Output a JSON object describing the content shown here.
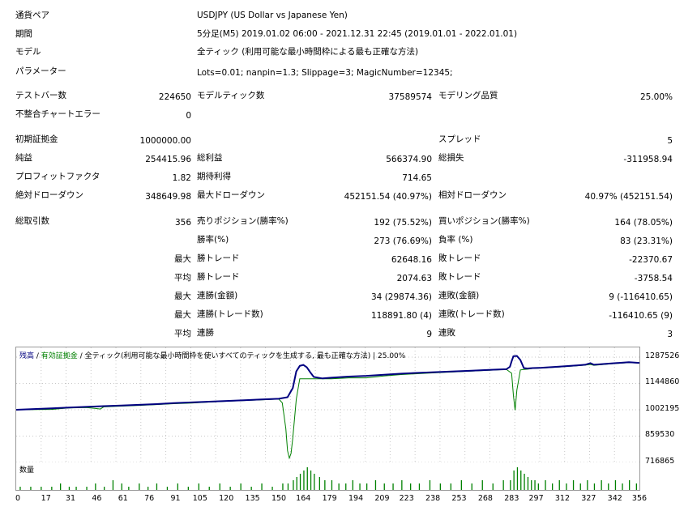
{
  "report": {
    "currency_pair_label": "通貨ペア",
    "currency_pair_value": "USDJPY (US Dollar vs Japanese Yen)",
    "period_label": "期間",
    "period_value": "5分足(M5) 2019.01.02 06:00 - 2021.12.31 22:45 (2019.01.01 - 2022.01.01)",
    "model_label": "モデル",
    "model_value": "全ティック (利用可能な最小時間枠による最も正確な方法)",
    "params_label": "パラメーター",
    "params_value": "Lots=0.01; nanpin=1.3; Slippage=3; MagicNumber=12345;"
  },
  "stats": {
    "test_bars_label": "テストバー数",
    "test_bars": "224650",
    "modeled_ticks_label": "モデルティック数",
    "modeled_ticks": "37589574",
    "modeling_quality_label": "モデリング品質",
    "modeling_quality": "25.00%",
    "mismatch_label": "不整合チャートエラー",
    "mismatch": "0",
    "initial_deposit_label": "初期証拠金",
    "initial_deposit": "1000000.00",
    "spread_label": "スプレッド",
    "spread": "5",
    "net_profit_label": "純益",
    "net_profit": "254415.96",
    "gross_profit_label": "総利益",
    "gross_profit": "566374.90",
    "gross_loss_label": "総損失",
    "gross_loss": "-311958.94",
    "profit_factor_label": "プロフィットファクタ",
    "profit_factor": "1.82",
    "expected_payoff_label": "期待利得",
    "expected_payoff": "714.65",
    "abs_dd_label": "絶対ドローダウン",
    "abs_dd": "348649.98",
    "max_dd_label": "最大ドローダウン",
    "max_dd": "452151.54 (40.97%)",
    "rel_dd_label": "相対ドローダウン",
    "rel_dd": "40.97% (452151.54)",
    "total_trades_label": "総取引数",
    "total_trades": "356",
    "short_label": "売りポジション(勝率%)",
    "short": "192 (75.52%)",
    "long_label": "買いポジション(勝率%)",
    "long": "164 (78.05%)",
    "win_pct_label": "勝率(%)",
    "win_pct": "273 (76.69%)",
    "loss_pct_label": "負率 (%)",
    "loss_pct": "83 (23.31%)",
    "max_label": "最大",
    "avg_label": "平均",
    "largest_win_label": "勝トレード",
    "largest_win": "62648.16",
    "largest_loss_label": "敗トレード",
    "largest_loss": "-22370.67",
    "avg_win_label": "勝トレード",
    "avg_win": "2074.63",
    "avg_loss_label": "敗トレード",
    "avg_loss": "-3758.54",
    "max_consec_wins_money_label": "連勝(金額)",
    "max_consec_wins_money": "34 (29874.36)",
    "max_consec_losses_money_label": "連敗(金額)",
    "max_consec_losses_money": "9 (-116410.65)",
    "max_consec_profit_label": "連勝(トレード数)",
    "max_consec_profit": "118891.80 (4)",
    "max_consec_loss_label": "連敗(トレード数)",
    "max_consec_loss": "-116410.65 (9)",
    "avg_consec_wins_label": "連勝",
    "avg_consec_wins": "9",
    "avg_consec_losses_label": "連敗",
    "avg_consec_losses": "3"
  },
  "chart_data": {
    "type": "line",
    "legend": {
      "balance": "残高",
      "sep1": " / ",
      "equity": "有効証拠金",
      "sep2": " / ",
      "model": "全ティック(利用可能な最小時間枠を使いすべてのティックを生成する, 最も正確な方法)",
      "sep3": " | ",
      "quality": "25.00%"
    },
    "volume_label": "数量",
    "y_ticks": [
      "1287526",
      "1144860",
      "1002195",
      "859530",
      "716865"
    ],
    "y_tick_values": [
      1287526,
      1144860,
      1002195,
      859530,
      716865
    ],
    "ylim": [
      716865,
      1340000
    ],
    "x_ticks": [
      "0",
      "17",
      "31",
      "46",
      "61",
      "76",
      "91",
      "105",
      "120",
      "135",
      "150",
      "164",
      "179",
      "194",
      "209",
      "223",
      "238",
      "253",
      "268",
      "283",
      "297",
      "312",
      "327",
      "342",
      "356"
    ],
    "xlim": [
      0,
      356
    ],
    "colors": {
      "balance": "#000080",
      "equity": "#008000",
      "volume": "#008000",
      "grid": "#c8c8c8"
    },
    "series": [
      {
        "name": "残高",
        "x": [
          0,
          10,
          20,
          30,
          40,
          50,
          60,
          70,
          80,
          90,
          100,
          110,
          120,
          130,
          140,
          150,
          155,
          158,
          160,
          162,
          164,
          166,
          168,
          170,
          175,
          180,
          190,
          200,
          210,
          220,
          230,
          240,
          250,
          260,
          270,
          280,
          282,
          283,
          284,
          286,
          288,
          290,
          292,
          295,
          300,
          310,
          320,
          325,
          328,
          330,
          340,
          350,
          356
        ],
        "values": [
          1002195,
          1006000,
          1010000,
          1014000,
          1018000,
          1022000,
          1025000,
          1029000,
          1033000,
          1038000,
          1042000,
          1046000,
          1050000,
          1054000,
          1058000,
          1062000,
          1070000,
          1120000,
          1210000,
          1240000,
          1245000,
          1232000,
          1205000,
          1180000,
          1172000,
          1176000,
          1182000,
          1186000,
          1192000,
          1198000,
          1202000,
          1206000,
          1210000,
          1214000,
          1218000,
          1222000,
          1235000,
          1265000,
          1292000,
          1294000,
          1272000,
          1228000,
          1226000,
          1228000,
          1230000,
          1236000,
          1242000,
          1246000,
          1255000,
          1246000,
          1253000,
          1260000,
          1256000
        ]
      },
      {
        "name": "有効証拠金",
        "x": [
          0,
          10,
          20,
          30,
          40,
          45,
          48,
          50,
          60,
          70,
          80,
          90,
          100,
          110,
          120,
          130,
          140,
          150,
          152,
          154,
          155,
          156,
          157,
          158,
          160,
          162,
          164,
          166,
          170,
          180,
          190,
          200,
          210,
          220,
          230,
          240,
          250,
          260,
          270,
          280,
          283,
          284,
          285,
          286,
          288,
          290,
          292,
          295,
          300,
          310,
          320,
          325,
          328,
          330,
          340,
          350,
          356
        ],
        "values": [
          1002195,
          1003000,
          1004000,
          1012000,
          1014000,
          1010000,
          1006000,
          1018000,
          1022000,
          1026000,
          1030000,
          1035000,
          1038000,
          1044000,
          1048000,
          1052000,
          1056000,
          1060000,
          1040000,
          900000,
          780000,
          740000,
          765000,
          850000,
          1060000,
          1170000,
          1170000,
          1170000,
          1170000,
          1170000,
          1175000,
          1175000,
          1185000,
          1193000,
          1198000,
          1203000,
          1207000,
          1212000,
          1216000,
          1221000,
          1200000,
          1080000,
          1000000,
          1110000,
          1218000,
          1220000,
          1222000,
          1226000,
          1228000,
          1234000,
          1240000,
          1244000,
          1248000,
          1243000,
          1251000,
          1258000,
          1255000
        ]
      }
    ],
    "volume": {
      "x": [
        2,
        8,
        14,
        20,
        25,
        30,
        34,
        40,
        45,
        50,
        55,
        60,
        64,
        70,
        75,
        80,
        86,
        92,
        98,
        104,
        110,
        116,
        122,
        128,
        134,
        140,
        146,
        152,
        155,
        158,
        160,
        162,
        164,
        166,
        168,
        170,
        173,
        176,
        180,
        184,
        188,
        192,
        196,
        200,
        205,
        210,
        215,
        220,
        225,
        230,
        236,
        242,
        248,
        254,
        260,
        266,
        272,
        278,
        282,
        284,
        286,
        288,
        290,
        292,
        294,
        296,
        298,
        302,
        306,
        310,
        314,
        318,
        322,
        326,
        330,
        334,
        338,
        342,
        346,
        350,
        354
      ],
      "values": [
        1,
        1,
        1,
        1,
        2,
        1,
        1,
        1,
        2,
        1,
        3,
        2,
        1,
        2,
        1,
        2,
        1,
        2,
        1,
        2,
        1,
        2,
        1,
        2,
        1,
        2,
        1,
        2,
        2,
        3,
        4,
        5,
        6,
        7,
        6,
        5,
        4,
        3,
        3,
        2,
        2,
        3,
        2,
        2,
        3,
        2,
        2,
        3,
        2,
        2,
        3,
        2,
        2,
        3,
        2,
        3,
        2,
        3,
        3,
        6,
        7,
        6,
        5,
        4,
        3,
        3,
        2,
        3,
        2,
        3,
        2,
        3,
        2,
        3,
        2,
        3,
        2,
        3,
        2,
        3,
        2
      ],
      "max": 7
    }
  }
}
